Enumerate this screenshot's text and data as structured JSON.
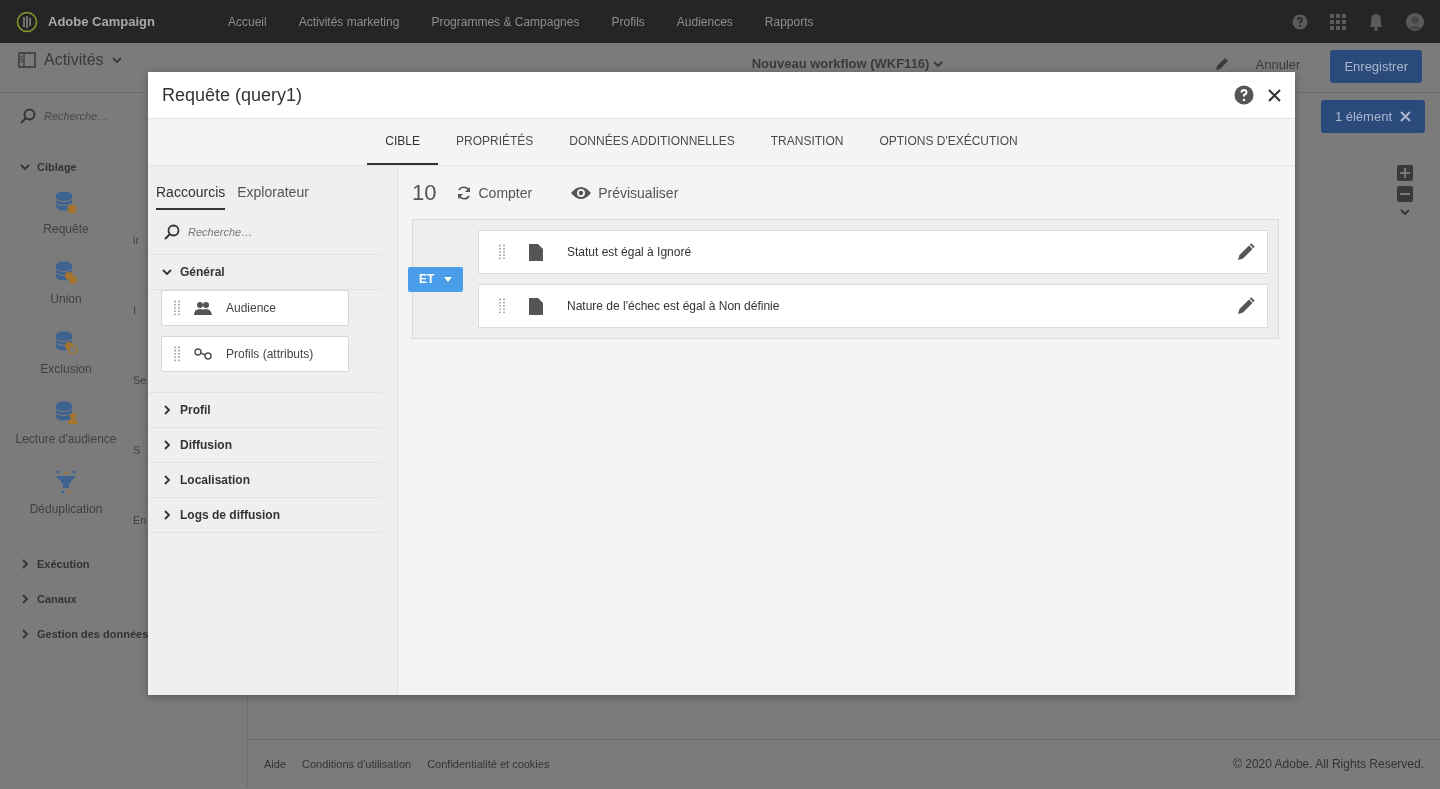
{
  "topbar": {
    "brand": "Adobe Campaign",
    "nav": [
      "Accueil",
      "Activités marketing",
      "Programmes & Campagnes",
      "Profils",
      "Audiences",
      "Rapports"
    ]
  },
  "header": {
    "menu": "Activités",
    "title": "Nouveau workflow (WKF116)",
    "cancel": "Annuler",
    "save": "Enregistrer"
  },
  "sidebar": {
    "search_placeholder": "Recherche…",
    "sections": [
      {
        "label": "Ciblage",
        "expanded": true,
        "activities": [
          {
            "label": "Requête",
            "kind": "query"
          },
          {
            "label": "ir",
            "kind": "partial"
          },
          {
            "label": "Union",
            "kind": "union"
          },
          {
            "label": "I",
            "kind": "partial"
          },
          {
            "label": "Exclusion",
            "kind": "exclusion"
          },
          {
            "label": "Se",
            "kind": "partial"
          },
          {
            "label": "Lecture d'audience",
            "kind": "audience"
          },
          {
            "label": "S",
            "kind": "partial"
          },
          {
            "label": "Déduplication",
            "kind": "dedup"
          },
          {
            "label": "En",
            "kind": "partial"
          }
        ]
      },
      {
        "label": "Exécution",
        "expanded": false
      },
      {
        "label": "Canaux",
        "expanded": false
      },
      {
        "label": "Gestion des données",
        "expanded": false
      }
    ]
  },
  "selection_badge": "1 élément",
  "footer": {
    "links": [
      "Aide",
      "Conditions d'utilisation",
      "Confidentialité et cookies"
    ],
    "copyright": "© 2020 Adobe. All Rights Reserved."
  },
  "dialog": {
    "title": "Requête (query1)",
    "tabs": [
      {
        "label": "CIBLE",
        "selected": true
      },
      {
        "label": "PROPRIÉTÉS",
        "selected": false
      },
      {
        "label": "DONNÉES ADDITIONNELLES",
        "selected": false
      },
      {
        "label": "TRANSITION",
        "selected": false
      },
      {
        "label": "OPTIONS D'EXÉCUTION",
        "selected": false
      }
    ],
    "panel_tabs": [
      {
        "label": "Raccourcis",
        "selected": true
      },
      {
        "label": "Explorateur",
        "selected": false
      }
    ],
    "search_placeholder": "Recherche…",
    "groups": [
      {
        "label": "Général",
        "expanded": true,
        "items": [
          {
            "label": "Audience",
            "kind": "audience"
          },
          {
            "label": "Profils (attributs)",
            "kind": "link"
          }
        ]
      },
      {
        "label": "Profil",
        "expanded": false
      },
      {
        "label": "Diffusion",
        "expanded": false
      },
      {
        "label": "Localisation",
        "expanded": false
      },
      {
        "label": "Logs de diffusion",
        "expanded": false
      }
    ],
    "count": "10",
    "count_button": "Compter",
    "preview_button": "Prévisualiser",
    "operator": "ET",
    "conditions": [
      "Statut est égal à Ignoré",
      "Nature de l'échec est égal à Non définie"
    ]
  }
}
